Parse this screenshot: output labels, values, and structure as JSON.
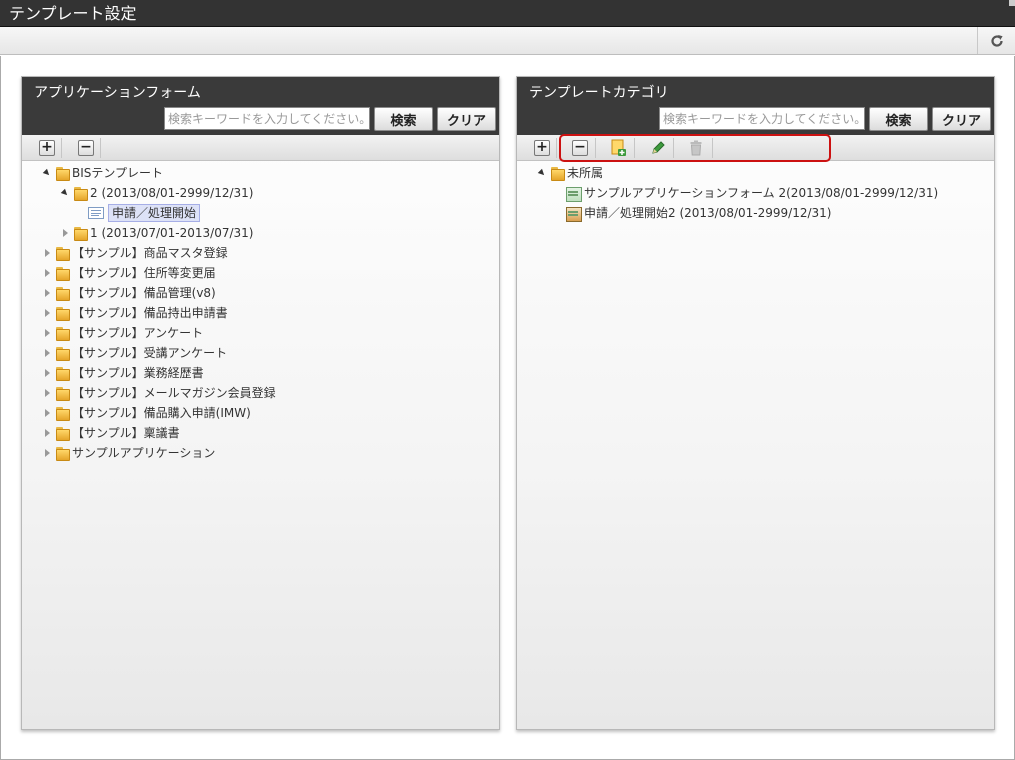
{
  "window": {
    "title": "テンプレート設定"
  },
  "toolbar": {
    "refresh_icon": "refresh-icon"
  },
  "left_panel": {
    "title": "アプリケーションフォーム",
    "search_placeholder": "検索キーワードを入力してください。",
    "search_label": "検索",
    "clear_label": "クリア",
    "tree": {
      "root": "BISテンプレート",
      "version_2": "2 (2013/08/01-2999/12/31)",
      "form_item": "申請／処理開始",
      "version_1": "1 (2013/07/01-2013/07/31)",
      "folders": [
        "【サンプル】商品マスタ登録",
        "【サンプル】住所等変更届",
        "【サンプル】備品管理(v8)",
        "【サンプル】備品持出申請書",
        "【サンプル】アンケート",
        "【サンプル】受講アンケート",
        "【サンプル】業務経歴書",
        "【サンプル】メールマガジン会員登録",
        "【サンプル】備品購入申請(IMW)",
        "【サンプル】稟議書",
        "サンプルアプリケーション"
      ]
    }
  },
  "right_panel": {
    "title": "テンプレートカテゴリ",
    "search_placeholder": "検索キーワードを入力してください。",
    "search_label": "検索",
    "clear_label": "クリア",
    "tree": {
      "root": "未所属",
      "items": [
        "サンプルアプリケーションフォーム 2(2013/08/01-2999/12/31)",
        "申請／処理開始2 (2013/08/01-2999/12/31)"
      ]
    }
  },
  "colors": {
    "header_bg": "#333333",
    "highlight": "#cc1111",
    "selection": "#dde2f7"
  }
}
